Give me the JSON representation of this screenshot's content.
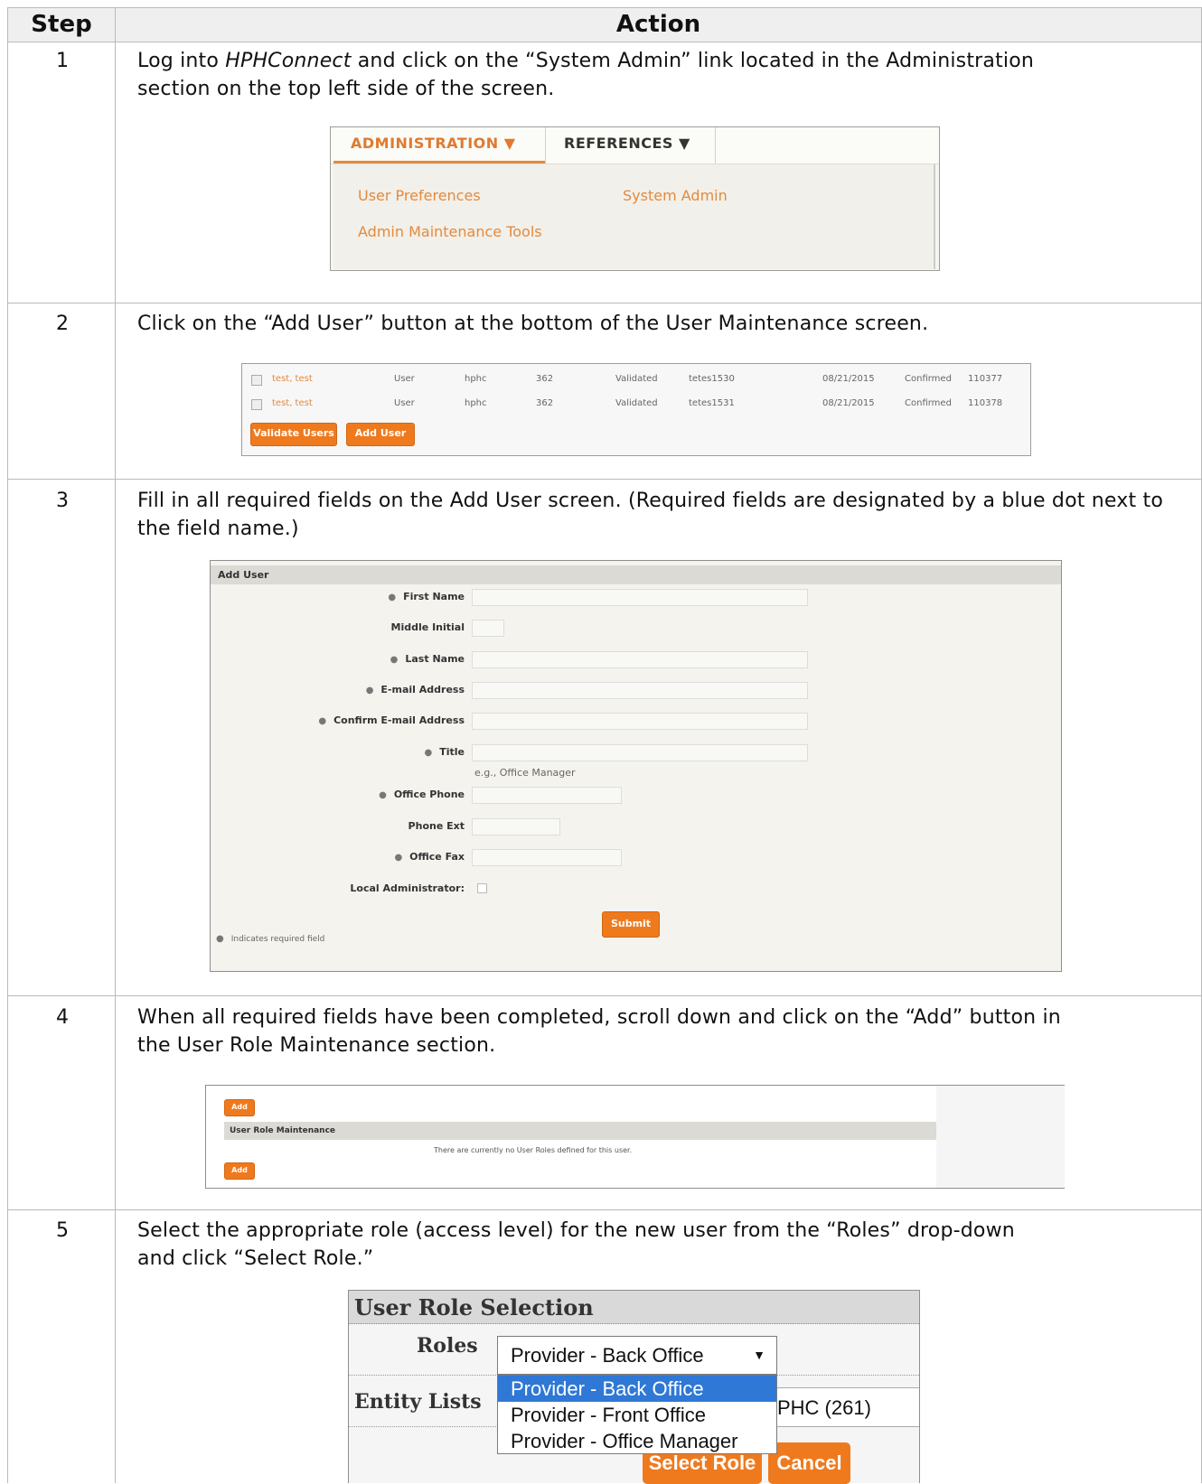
{
  "header": {
    "step": "Step",
    "action": "Action"
  },
  "steps": [
    {
      "num": "1",
      "pre": "Log into ",
      "app": "HPHConnect",
      "post": " and click on the “System Admin” link located in the Administration",
      "line2": "section on the top left side of the screen."
    },
    {
      "num": "2",
      "line1": "Click on the “Add User” button at the bottom of the User Maintenance screen."
    },
    {
      "num": "3",
      "line1": "Fill in all required fields on the Add User screen. (Required fields are designated by a blue dot next to",
      "line2": "the field name.)"
    },
    {
      "num": "4",
      "line1": "When all required fields have been completed, scroll down and click on the “Add” button in",
      "line2": "the User Role Maintenance section."
    },
    {
      "num": "5",
      "line1": "Select the appropriate role (access level) for the new user from the “Roles” drop-down",
      "line2": "and click “Select Role.”"
    }
  ],
  "shot1": {
    "tab_admin": "ADMINISTRATION ▼",
    "tab_refs": "REFERENCES ▼",
    "links": {
      "user_prefs": "User Preferences",
      "system_admin": "System Admin",
      "admin_tools": "Admin Maintenance Tools"
    }
  },
  "shot2": {
    "rows": [
      {
        "name": "test, test",
        "type": "User",
        "org": "hphc",
        "num": "362",
        "status": "Validated",
        "login": "tetes1530",
        "date": "08/21/2015",
        "conf": "Confirmed",
        "id": "110377"
      },
      {
        "name": "test, test",
        "type": "User",
        "org": "hphc",
        "num": "362",
        "status": "Validated",
        "login": "tetes1531",
        "date": "08/21/2015",
        "conf": "Confirmed",
        "id": "110378"
      }
    ],
    "validate_btn": "Validate Users",
    "add_btn": "Add User"
  },
  "shot3": {
    "title": "Add User",
    "fields": {
      "first_name": "First Name",
      "middle_initial": "Middle Initial",
      "last_name": "Last Name",
      "email": "E-mail Address",
      "confirm_email": "Confirm E-mail Address",
      "title": "Title",
      "title_hint": "e.g., Office Manager",
      "office_phone": "Office Phone",
      "phone_ext": "Phone Ext",
      "office_fax": "Office Fax",
      "local_admin": "Local Administrator:"
    },
    "submit": "Submit",
    "required_note": "Indicates required field"
  },
  "shot4": {
    "add": "Add",
    "section": "User Role Maintenance",
    "empty": "There are currently no User Roles defined for this user."
  },
  "shot5": {
    "title": "User Role Selection",
    "roles_label": "Roles",
    "entity_label": "Entity Lists",
    "selected": "Provider - Back Office",
    "options": [
      "Provider - Back Office",
      "Provider - Front Office",
      "Provider - Office Manager"
    ],
    "entity_value": "PHC (261)",
    "select_btn": "Select Role",
    "cancel_btn": "Cancel"
  }
}
